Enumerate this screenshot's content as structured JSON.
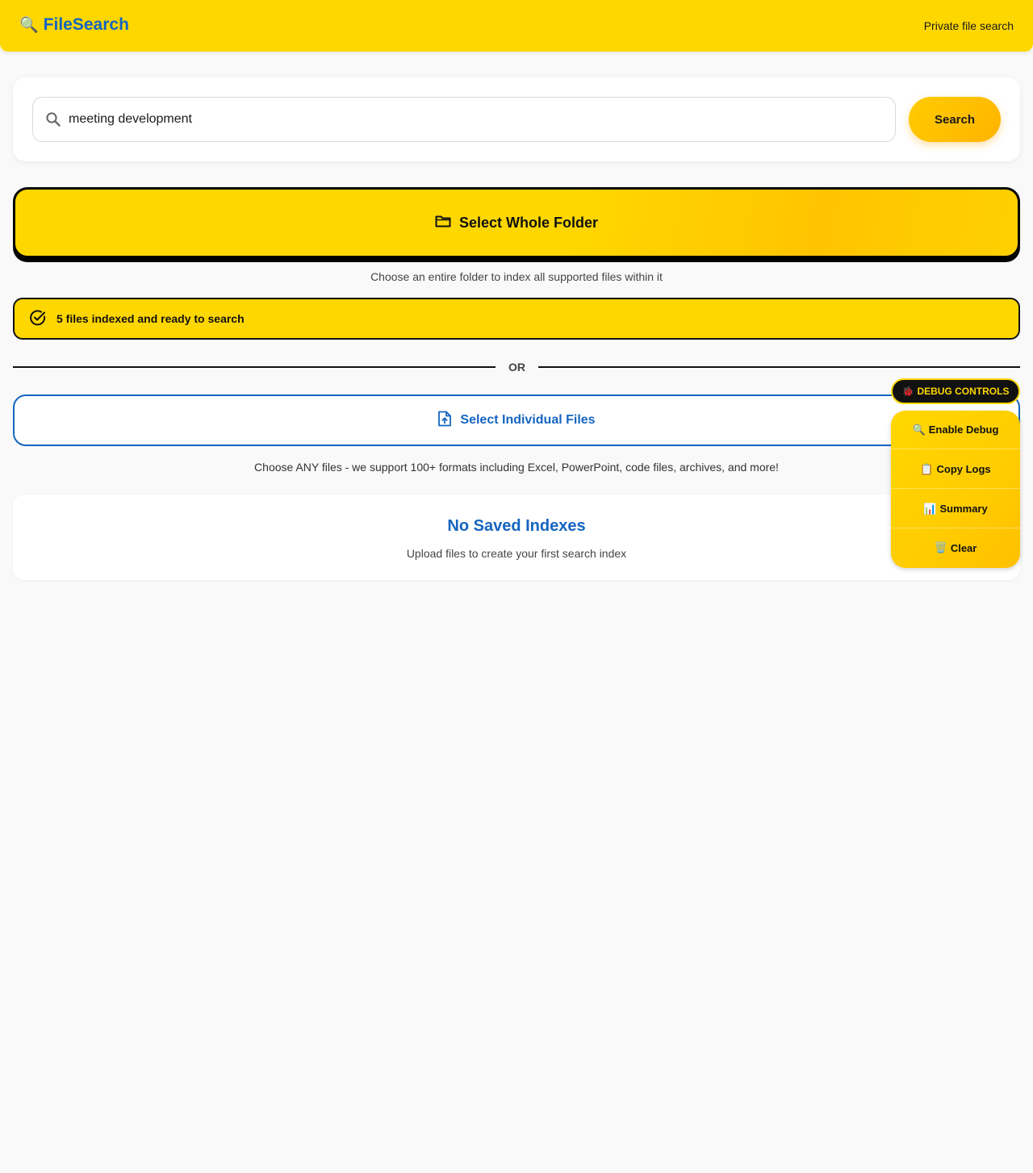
{
  "header": {
    "brand_icon": "🔍",
    "brand_name": "FileSearch",
    "tagline": "Private file search"
  },
  "search": {
    "value": "meeting development",
    "button_label": "Search",
    "icon": "search-icon"
  },
  "folder_select": {
    "label": "Select Whole Folder",
    "icon": "folder-icon",
    "hint": "Choose an entire folder to index all supported files within it"
  },
  "status": {
    "icon": "check-circle-icon",
    "text": "5 files indexed and ready to search"
  },
  "divider": {
    "text": "OR"
  },
  "files_select": {
    "label": "Select Individual Files",
    "icon": "file-upload-icon",
    "hint": "Choose ANY files - we support 100+ formats including Excel, PowerPoint, code files, archives, and more!"
  },
  "saved_indexes": {
    "title": "No Saved Indexes",
    "subtitle": "Upload files to create your first search index"
  },
  "debug": {
    "toggle_icon": "🐞",
    "toggle_label": "DEBUG CONTROLS",
    "items": [
      {
        "icon": "🔍",
        "label": "Enable Debug"
      },
      {
        "icon": "📋",
        "label": "Copy Logs"
      },
      {
        "icon": "📊",
        "label": "Summary"
      },
      {
        "icon": "🗑️",
        "label": "Clear"
      }
    ]
  },
  "colors": {
    "accent_yellow": "#FFD700",
    "brand_blue": "#1565C0",
    "dark": "#111111"
  }
}
